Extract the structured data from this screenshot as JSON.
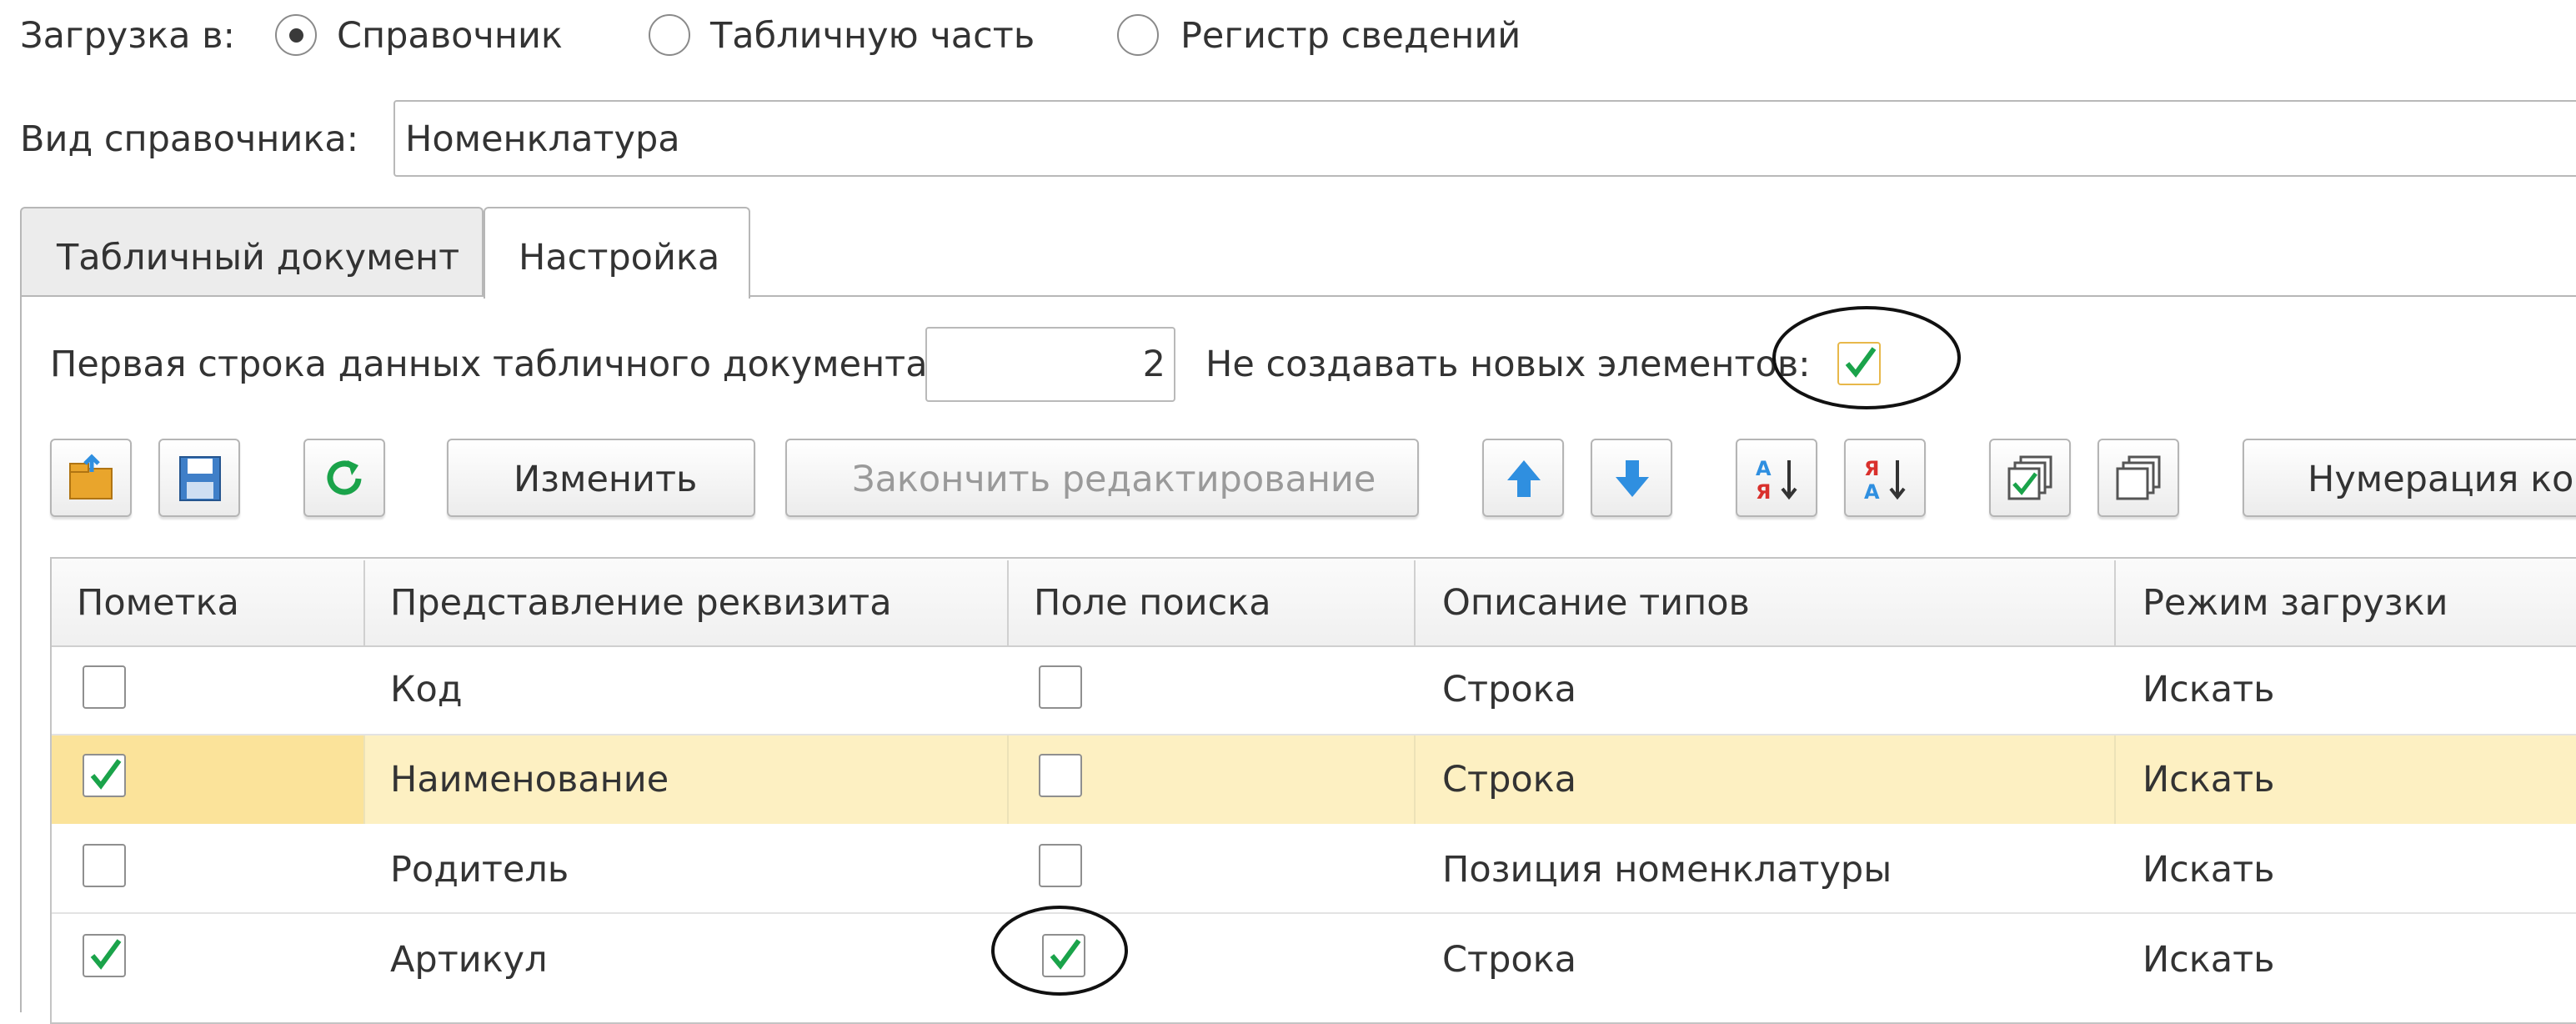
{
  "load_to": {
    "label": "Загрузка в:",
    "options": [
      {
        "label": "Справочник",
        "selected": true
      },
      {
        "label": "Табличную часть",
        "selected": false
      },
      {
        "label": "Регистр сведений",
        "selected": false
      }
    ]
  },
  "catalog": {
    "label": "Вид справочника:",
    "value": "Номенклатура"
  },
  "tabs": [
    {
      "label": "Табличный документ",
      "active": false
    },
    {
      "label": "Настройка",
      "active": true
    }
  ],
  "settings": {
    "first_row_label": "Первая строка данных табличного документа:",
    "first_row_value": "2",
    "no_new_label": "Не создавать новых элементов:",
    "no_new_checked": true
  },
  "toolbar": {
    "open_icon": "folder-open-icon",
    "save_icon": "floppy-disk-icon",
    "refresh_icon": "refresh-icon",
    "change_label": "Изменить",
    "finish_edit_label": "Закончить редактирование",
    "up_icon": "arrow-up-icon",
    "down_icon": "arrow-down-icon",
    "sort_asc_icon": "sort-ascending-icon",
    "sort_desc_icon": "sort-descending-icon",
    "check_all_icon": "check-all-icon",
    "uncheck_all_icon": "uncheck-all-icon",
    "numbering_label": "Нумерация ко..."
  },
  "table": {
    "columns": [
      "Пометка",
      "Представление реквизита",
      "Поле поиска",
      "Описание типов",
      "Режим загрузки"
    ],
    "rows": [
      {
        "mark": false,
        "name": "Код",
        "search": false,
        "type": "Строка",
        "mode": "Искать",
        "selected": false
      },
      {
        "mark": true,
        "name": "Наименование",
        "search": false,
        "type": "Строка",
        "mode": "Искать",
        "selected": true
      },
      {
        "mark": false,
        "name": "Родитель",
        "search": false,
        "type": "Позиция номенклатуры",
        "mode": "Искать",
        "selected": false
      },
      {
        "mark": true,
        "name": "Артикул",
        "search": true,
        "type": "Строка",
        "mode": "Искать",
        "selected": false
      }
    ]
  },
  "colors": {
    "check": "#1aa34a",
    "selected_row": "#fdf0c2",
    "accent_blue": "#2f8fe0"
  }
}
